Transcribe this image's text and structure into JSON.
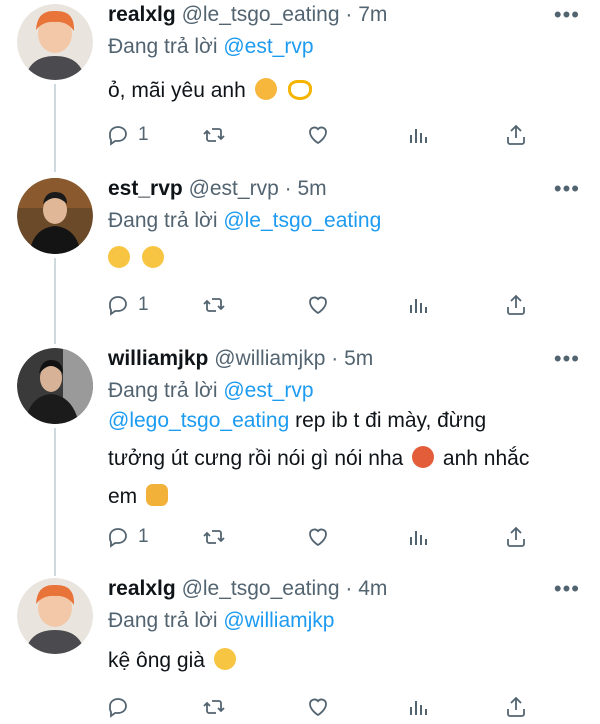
{
  "tweets": [
    {
      "name": "realxlg",
      "handle": "@le_tsgo_eating",
      "separator": "·",
      "time": "7m",
      "reply_prefix": "Đang trả lời",
      "reply_to": "@est_rvp",
      "text": "ỏ, mãi yêu anh",
      "reply_count": "1",
      "avatar_color": "#e8905c"
    },
    {
      "name": "est_rvp",
      "handle": "@est_rvp",
      "separator": "·",
      "time": "5m",
      "reply_prefix": "Đang trả lời",
      "reply_to": "@le_tsgo_eating",
      "text": "",
      "reply_count": "1",
      "avatar_color": "#4a3a2a"
    },
    {
      "name": "williamjkp",
      "handle": "@williamjkp",
      "separator": "·",
      "time": "5m",
      "reply_prefix": "Đang trả lời",
      "reply_to": "@est_rvp",
      "mention": "@lego_tsgo_eating",
      "text_line1": " rep ib t đi mày, đừng",
      "text_line2": "tưởng út cưng rồi nói gì nói nha",
      "text_line2b": " anh nhắc",
      "text_line3": "em",
      "reply_count": "1",
      "avatar_color": "#2b2b2b"
    },
    {
      "name": "realxlg",
      "handle": "@le_tsgo_eating",
      "separator": "·",
      "time": "4m",
      "reply_prefix": "Đang trả lời",
      "reply_to": "@williamjkp",
      "text": "kệ ông già",
      "avatar_color": "#e8905c"
    }
  ],
  "more_glyph": "•••",
  "icons": [
    "reply-icon",
    "retweet-icon",
    "like-icon",
    "views-icon",
    "share-icon",
    "more-icon"
  ]
}
